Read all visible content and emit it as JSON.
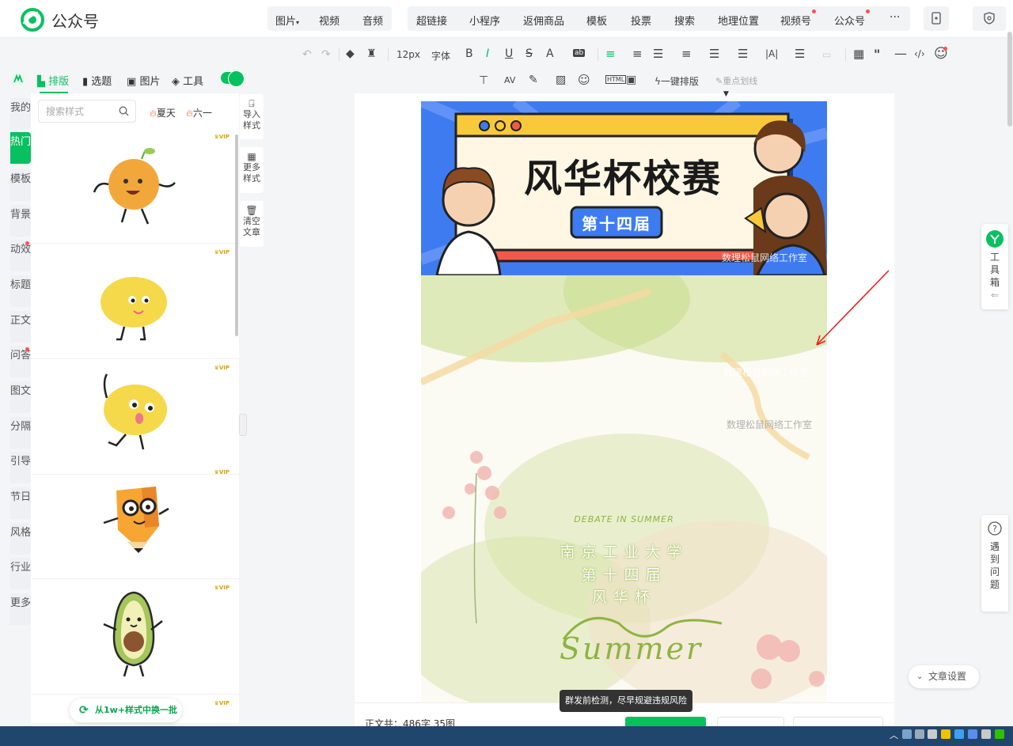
{
  "app": {
    "brand": "公众号"
  },
  "top_nav": {
    "group1": [
      "图片",
      "视频",
      "音频"
    ],
    "group1_caret": "▾",
    "group2": [
      "超链接",
      "小程序",
      "返佣商品",
      "模板",
      "投票",
      "搜索",
      "地理位置",
      "视频号",
      "公众号"
    ],
    "more": "···"
  },
  "format_toolbar": {
    "font_size": "12px",
    "font_family": "字体",
    "bold": "B",
    "italic": "I",
    "underline": "U",
    "strike": "S",
    "font_color": "A",
    "oneclick": "一键排版",
    "highlight": "重点划线"
  },
  "left_tabs": {
    "layout": "排版",
    "topics": "选题",
    "images": "图片",
    "tools": "工具"
  },
  "categories": [
    {
      "label": "我的",
      "active": false,
      "dot": false
    },
    {
      "label": "热门",
      "active": true,
      "dot": false
    },
    {
      "label": "模板",
      "active": false,
      "dot": false
    },
    {
      "label": "背景",
      "active": false,
      "dot": false
    },
    {
      "label": "动效",
      "active": false,
      "dot": true
    },
    {
      "label": "标题",
      "active": false,
      "dot": false
    },
    {
      "label": "正文",
      "active": false,
      "dot": false
    },
    {
      "label": "问答",
      "active": false,
      "dot": true
    },
    {
      "label": "图文",
      "active": false,
      "dot": false
    },
    {
      "label": "分隔",
      "active": false,
      "dot": false
    },
    {
      "label": "引导",
      "active": false,
      "dot": false
    },
    {
      "label": "节日",
      "active": false,
      "dot": false
    },
    {
      "label": "风格",
      "active": false,
      "dot": false
    },
    {
      "label": "行业",
      "active": false,
      "dot": false
    },
    {
      "label": "更多",
      "active": false,
      "dot": false
    }
  ],
  "style_panel": {
    "search_placeholder": "搜索样式",
    "hot_tags": [
      "夏天",
      "六一"
    ],
    "vip_label": "VIP",
    "swap_button": "从1w+样式中换一批"
  },
  "side_tools": [
    {
      "label": "导入样式"
    },
    {
      "label": "更多样式"
    },
    {
      "label": "清空文章"
    }
  ],
  "article": {
    "banner_title": "风华杯校赛",
    "banner_badge": "第十四届",
    "watermark": "数理松鼠网络工作室",
    "summer_en": "DEBATE IN SUMMER",
    "school": "南京工业大学",
    "session": "第十四届",
    "cup": "风华杯",
    "script": "Summer"
  },
  "status": {
    "count_label": "正文共：",
    "count_value": "486字 35图",
    "tooltip": "群发前检测，尽早规避违规风险"
  },
  "right_float": {
    "toolbox": "工具箱",
    "help": "遇到问题",
    "settings": "文章设置"
  },
  "colors": {
    "accent": "#07c160",
    "red_dot": "#fa5151"
  }
}
